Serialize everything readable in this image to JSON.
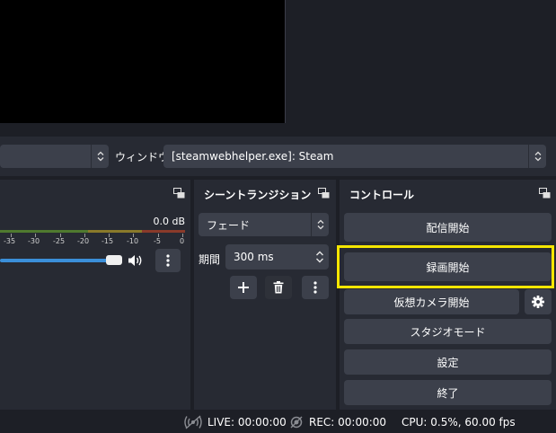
{
  "properties_bar": {
    "window_label": "ウィンドウ",
    "window_value": "[steamwebhelper.exe]: Steam"
  },
  "mixer": {
    "db_value": "0.0 dB",
    "ticks": [
      "-35",
      "-30",
      "-25",
      "-20",
      "-15",
      "-10",
      "-5",
      "0"
    ],
    "volume_fraction": 0.95
  },
  "transitions": {
    "title": "シーントランジション",
    "type_value": "フェード",
    "duration_label": "期間",
    "duration_value": "300 ms"
  },
  "controls": {
    "title": "コントロール",
    "stream_button": "配信開始",
    "record_button": "録画開始",
    "virtual_cam_button": "仮想カメラ開始",
    "studio_mode_button": "スタジオモード",
    "settings_button": "設定",
    "exit_button": "終了"
  },
  "statusbar": {
    "live": "LIVE: 00:00:00",
    "rec": "REC: 00:00:00",
    "cpu": "CPU: 0.5%, 60.00 fps"
  },
  "colors": {
    "highlight": "#f5e600",
    "slider": "#3b8fd9",
    "meter_green": "#4f7a2f",
    "meter_yellow": "#8a7a2a",
    "meter_red": "#8a3a2a"
  }
}
